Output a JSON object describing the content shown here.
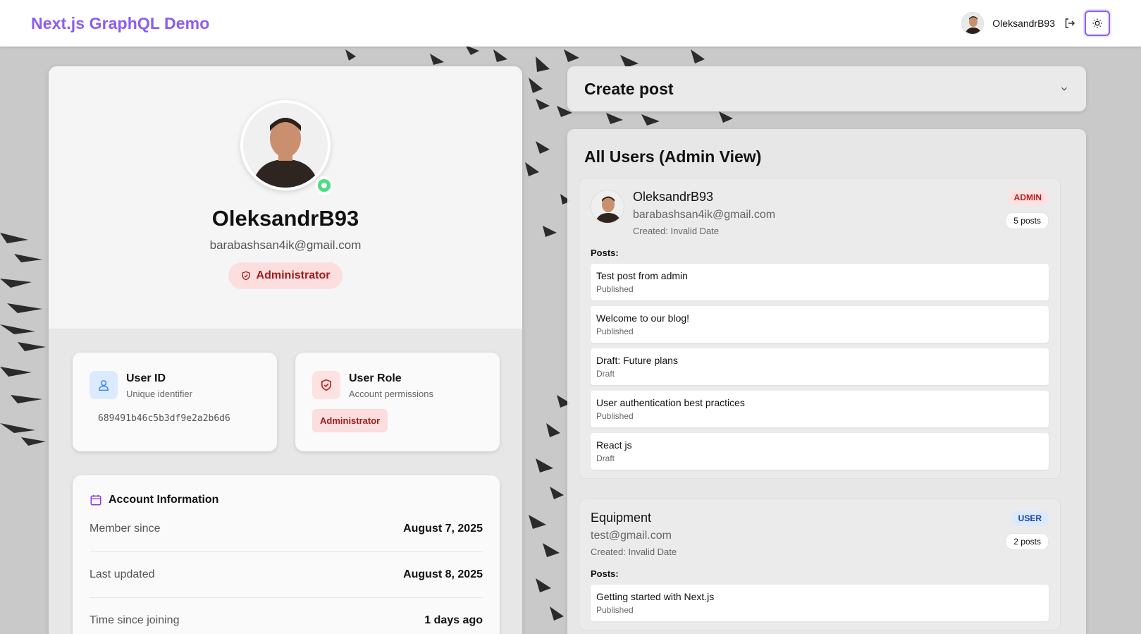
{
  "header": {
    "brand": "Next.js GraphQL Demo",
    "username": "OleksandrB93",
    "icons": {
      "logout": "logout-icon",
      "theme": "sun-icon"
    }
  },
  "profile": {
    "name": "OleksandrB93",
    "email": "barabashsan4ik@gmail.com",
    "role_label": "Administrator",
    "user_id_card": {
      "title": "User ID",
      "subtitle": "Unique identifier",
      "value": "689491b46c5b3df9e2a2b6d6"
    },
    "user_role_card": {
      "title": "User Role",
      "subtitle": "Account permissions",
      "value": "Administrator"
    },
    "account_info": {
      "title": "Account Information",
      "rows": [
        {
          "label": "Member since",
          "value": "August 7, 2025"
        },
        {
          "label": "Last updated",
          "value": "August 8, 2025"
        },
        {
          "label": "Time since joining",
          "value": "1 days ago"
        }
      ]
    }
  },
  "create_post": {
    "title": "Create post"
  },
  "users_panel": {
    "title": "All Users (Admin View)",
    "users": [
      {
        "name": "OleksandrB93",
        "email": "barabashsan4ik@gmail.com",
        "created": "Created: Invalid Date",
        "role": "ADMIN",
        "posts_count": "5 posts",
        "posts_label": "Posts:",
        "posts": [
          {
            "title": "Test post from admin",
            "status": "Published"
          },
          {
            "title": "Welcome to our blog!",
            "status": "Published"
          },
          {
            "title": "Draft: Future plans",
            "status": "Draft"
          },
          {
            "title": "User authentication best practices",
            "status": "Published"
          },
          {
            "title": "React js",
            "status": "Draft"
          }
        ]
      },
      {
        "name": "Equipment",
        "email": "test@gmail.com",
        "created": "Created: Invalid Date",
        "role": "USER",
        "posts_count": "2 posts",
        "posts_label": "Posts:",
        "posts": [
          {
            "title": "Getting started with Next.js",
            "status": "Published"
          }
        ]
      }
    ]
  },
  "colors": {
    "brand": "#8b5cf6",
    "admin_red": "#b91c1c",
    "user_blue": "#1e40af",
    "online_green": "#4ade80"
  }
}
